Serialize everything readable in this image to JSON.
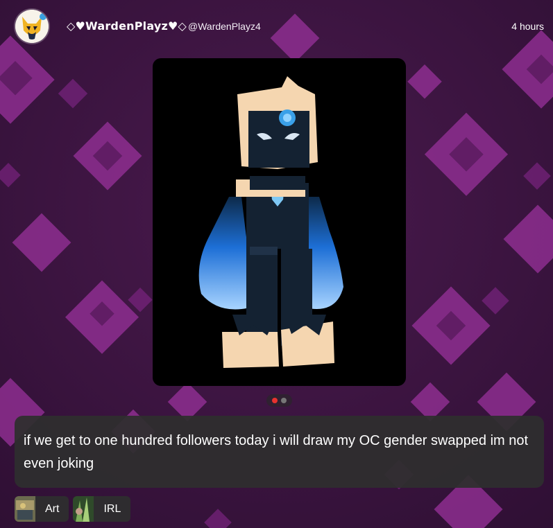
{
  "post": {
    "author": {
      "display_name": "◇♥WardenPlayz♥◇",
      "handle": "@WardenPlayz4",
      "avatar_icon": "cat-avatar-icon"
    },
    "timestamp": "4 hours",
    "media": {
      "image_icon": "character-drawing",
      "carousel_count": 2,
      "carousel_active": 1
    },
    "caption": "if we get to one hundred followers today i will draw my OC gender swapped im not even joking",
    "tags": [
      {
        "label": "Art",
        "icon": "art-thumbnail-icon"
      },
      {
        "label": "IRL",
        "icon": "irl-thumbnail-icon"
      }
    ]
  },
  "colors": {
    "background": "#3a1240",
    "diamond": "#8a2a8c",
    "card": "#2e2e2e",
    "active_dot": "#e8322f"
  }
}
